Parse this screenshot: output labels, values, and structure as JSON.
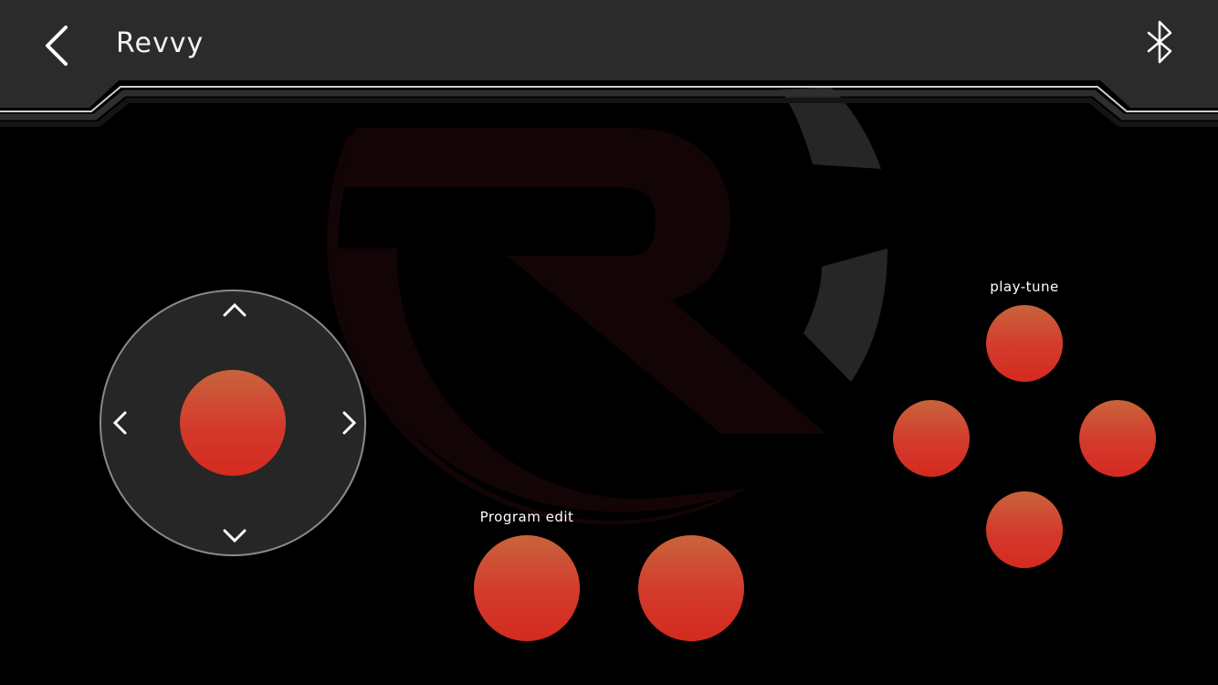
{
  "header": {
    "title": "Revvy",
    "back_icon": "chevron-left-icon",
    "bluetooth_icon": "bluetooth-icon"
  },
  "colors": {
    "header_bg": "#2b2b2b",
    "button_top": "#c8643c",
    "button_bottom": "#d52a20",
    "joystick_bg": "#262626",
    "watermark": "#130505"
  },
  "joystick": {
    "up_icon": "chevron-up-icon",
    "down_icon": "chevron-down-icon",
    "left_icon": "chevron-left-icon",
    "right_icon": "chevron-right-icon"
  },
  "buttons": {
    "program_label": "Program edit",
    "play_label": "play-tune"
  }
}
